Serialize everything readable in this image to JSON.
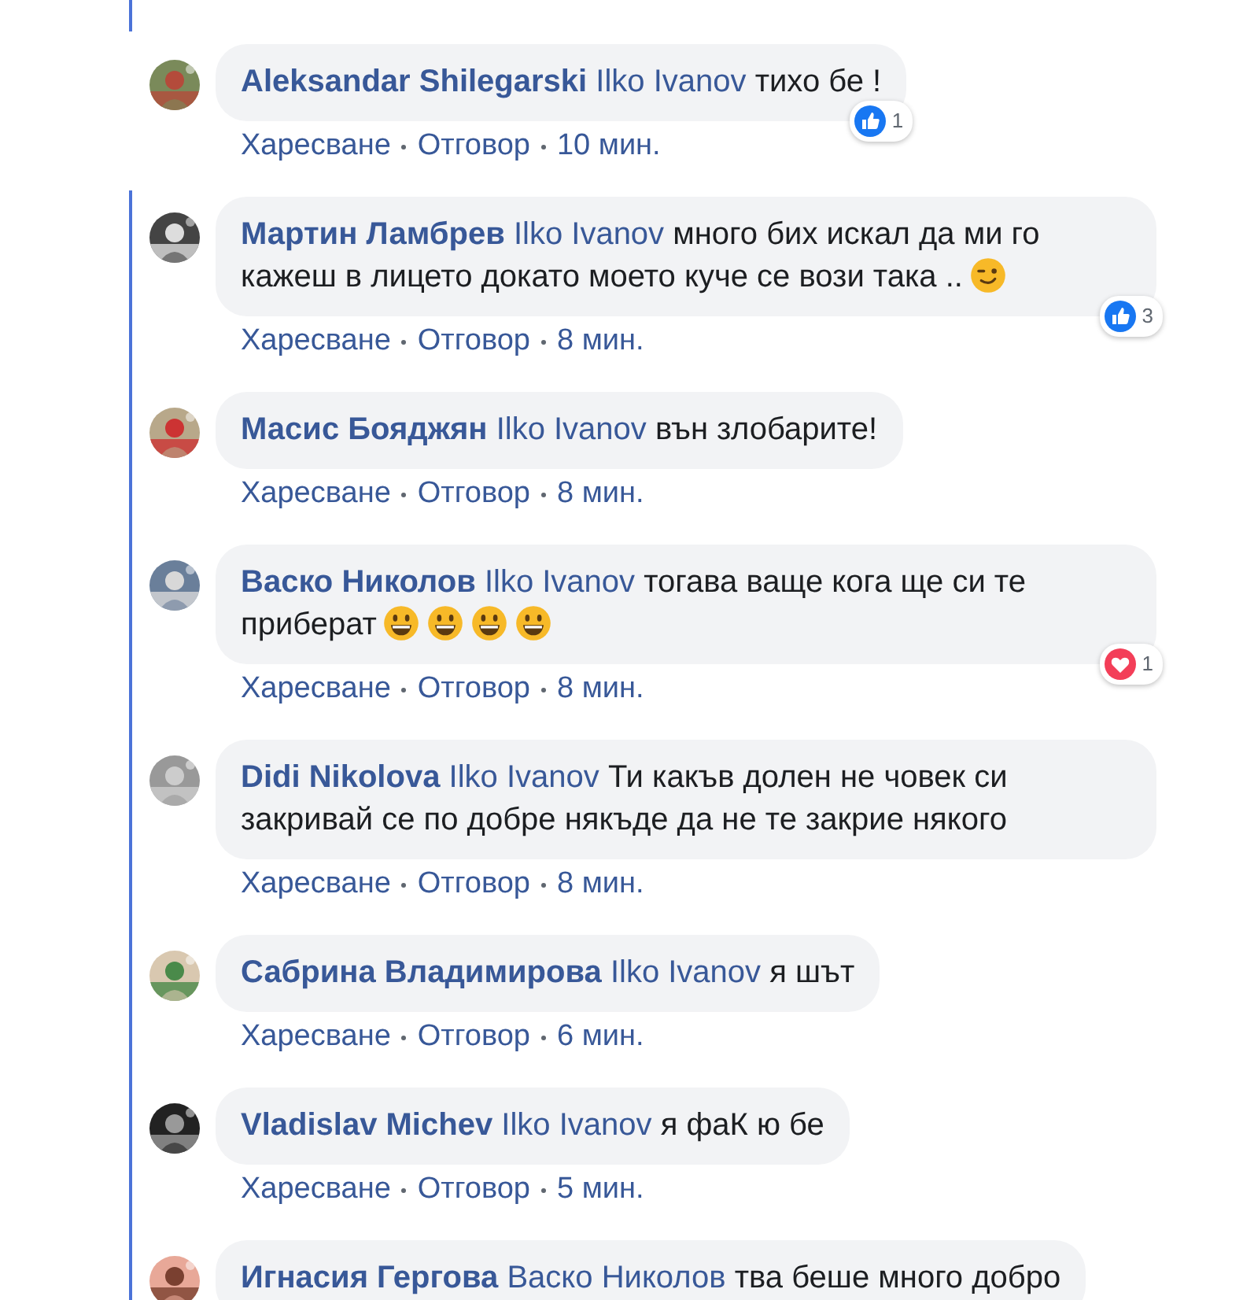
{
  "comments": [
    {
      "author": "Aleksandar Shilegarski",
      "mention": "Ilko Ivanov",
      "text": "тихо бе !",
      "in_thread": false,
      "reaction": {
        "kind": "like",
        "count": "1"
      },
      "actions": [
        "Харесване",
        "Отговор"
      ],
      "time": "10 мин."
    },
    {
      "author": "Мартин Ламбрев",
      "mention": "Ilko Ivanov",
      "text": "много бих искал да ми го кажеш в лицето докато моето куче се вози така ..",
      "emojis": [
        {
          "kind": "wink"
        }
      ],
      "in_thread": true,
      "reaction": {
        "kind": "like",
        "count": "3"
      },
      "actions": [
        "Харесване",
        "Отговор"
      ],
      "time": "8 мин."
    },
    {
      "author": "Масис Бояджян",
      "mention": "Ilko Ivanov",
      "text": "вън злобарите!",
      "in_thread": true,
      "actions": [
        "Харесване",
        "Отговор"
      ],
      "time": "8 мин."
    },
    {
      "author": "Васко Николов",
      "mention": "Ilko Ivanov",
      "text": "тогава ваще кога ще си те приберат",
      "emojis": [
        {
          "kind": "grin"
        },
        {
          "kind": "grin"
        },
        {
          "kind": "grin"
        },
        {
          "kind": "grin"
        }
      ],
      "in_thread": true,
      "reaction": {
        "kind": "love",
        "count": "1"
      },
      "actions": [
        "Харесване",
        "Отговор"
      ],
      "time": "8 мин."
    },
    {
      "author": "Didi Nikolova",
      "mention": "Ilko Ivanov",
      "text": "Ти какъв долен не човек си закривай се по добре някъде да не те закрие някого",
      "in_thread": true,
      "actions": [
        "Харесване",
        "Отговор"
      ],
      "time": "8 мин."
    },
    {
      "author": "Сабрина Владимирова",
      "mention": "Ilko Ivanov",
      "text": "я шът",
      "in_thread": true,
      "actions": [
        "Харесване",
        "Отговор"
      ],
      "time": "6 мин."
    },
    {
      "author": "Vladislav Michev",
      "mention": "Ilko Ivanov",
      "text": "я фаК ю бе",
      "in_thread": true,
      "actions": [
        "Харесване",
        "Отговор"
      ],
      "time": "5 мин."
    },
    {
      "author": "Игнасия Гергова",
      "mention": "Васко Николов",
      "text": "тва беше много добро",
      "in_thread": true
    }
  ]
}
